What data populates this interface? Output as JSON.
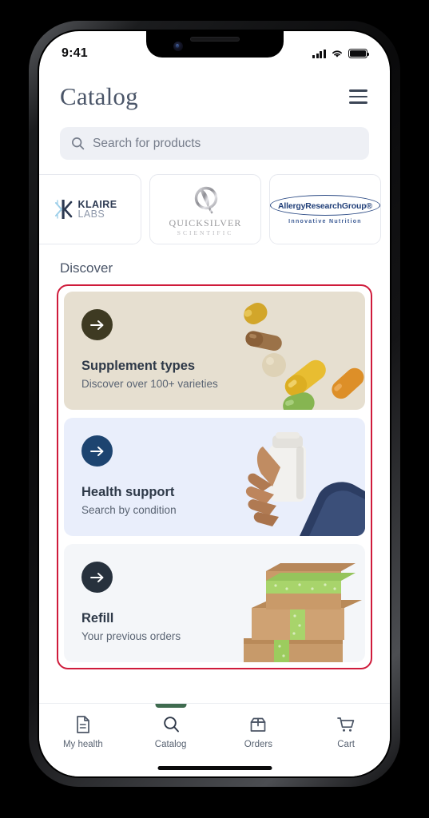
{
  "status_bar": {
    "time": "9:41",
    "cellular_icon": "signal-bars-icon",
    "wifi_icon": "wifi-icon",
    "battery_icon": "battery-full-icon"
  },
  "header": {
    "title": "Catalog",
    "menu_icon": "hamburger-menu-icon"
  },
  "search": {
    "placeholder": "Search for products",
    "value": "",
    "icon": "search-icon"
  },
  "brands": [
    {
      "id": "klaire-labs",
      "line1": "KLAIRE",
      "line2": "LABS",
      "mark": "klaire-snowflake-k-logo"
    },
    {
      "id": "quicksilver-scientific",
      "line1": "QUICKSILVER",
      "line2": "SCIENTIFIC",
      "mark": "quicksilver-quill-q-logo"
    },
    {
      "id": "allergy-research-group",
      "line1": "AllergyResearchGroup®",
      "line2": "Innovative Nutrition",
      "mark": "allergy-research-group-oval-logo"
    }
  ],
  "discover": {
    "section_title": "Discover",
    "highlight_color": "#cf1b3b",
    "cards": [
      {
        "id": "supplement-types",
        "title": "Supplement types",
        "subtitle": "Discover over 100+ varieties",
        "bg_color": "#e6dfd0",
        "arrow_color": "#3e3a22",
        "art": "falling-supplement-pills-image"
      },
      {
        "id": "health-support",
        "title": "Health support",
        "subtitle": "Search by condition",
        "bg_color": "#e9eefb",
        "arrow_color": "#1d4470",
        "art": "hand-holding-supplement-bottle-image"
      },
      {
        "id": "refill",
        "title": "Refill",
        "subtitle": "Your previous orders",
        "bg_color": "#f4f6f9",
        "arrow_color": "#27313d",
        "art": "stacked-shipping-boxes-image"
      }
    ]
  },
  "bottom_nav": {
    "active_id": "catalog",
    "indicator_color": "#3f6b4f",
    "items": [
      {
        "id": "my-health",
        "label": "My health",
        "icon": "document-icon"
      },
      {
        "id": "catalog",
        "label": "Catalog",
        "icon": "search-icon"
      },
      {
        "id": "orders",
        "label": "Orders",
        "icon": "open-box-icon"
      },
      {
        "id": "cart",
        "label": "Cart",
        "icon": "shopping-cart-icon"
      }
    ]
  }
}
